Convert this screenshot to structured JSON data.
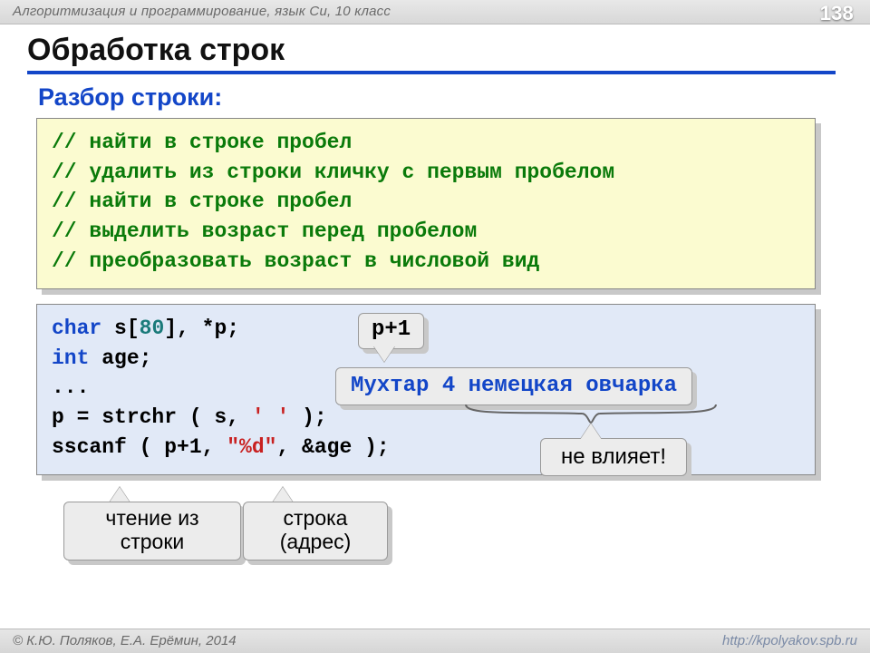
{
  "header": {
    "course": "Алгоритмизация и программирование, язык Си, 10 класс",
    "page": "138"
  },
  "title": "Обработка строк",
  "subtitle": "Разбор строки:",
  "comments": {
    "line1_a": "// ",
    "line1_b": "найти в строке пробел",
    "line2_a": "// ",
    "line2_b": "удалить из строки кличку с первым пробелом",
    "line3_a": "// ",
    "line3_b": "найти в строке пробел",
    "line4_a": "// ",
    "line4_b": "выделить возраст перед пробелом",
    "line5_a": "// ",
    "line5_b": "преобразовать возраст в числовой вид"
  },
  "code": {
    "kw_char": "char",
    "decl_rest": " s[",
    "arr_size": "80",
    "decl_tail": "], *p;",
    "kw_int": "int",
    "int_tail": " age;",
    "dots": "...",
    "p_assign": "p = strchr ( s, ",
    "space_literal": "' '",
    "p_assign_tail": " );",
    "sscanf_a": "sscanf ( p+1, ",
    "fmt": "\"%d\"",
    "sscanf_b": ", &age );"
  },
  "hints": {
    "pplus1": "p+1",
    "example": "Мухтар 4 немецкая овчарка",
    "no_effect": "не влияет!",
    "read_from_string_l1": "чтение из",
    "read_from_string_l2": "строки",
    "string_addr_l1": "строка",
    "string_addr_l2": "(адрес)"
  },
  "footer": {
    "copyright": "© К.Ю. Поляков, Е.А. Ерёмин, 2014",
    "url": "http://kpolyakov.spb.ru"
  }
}
